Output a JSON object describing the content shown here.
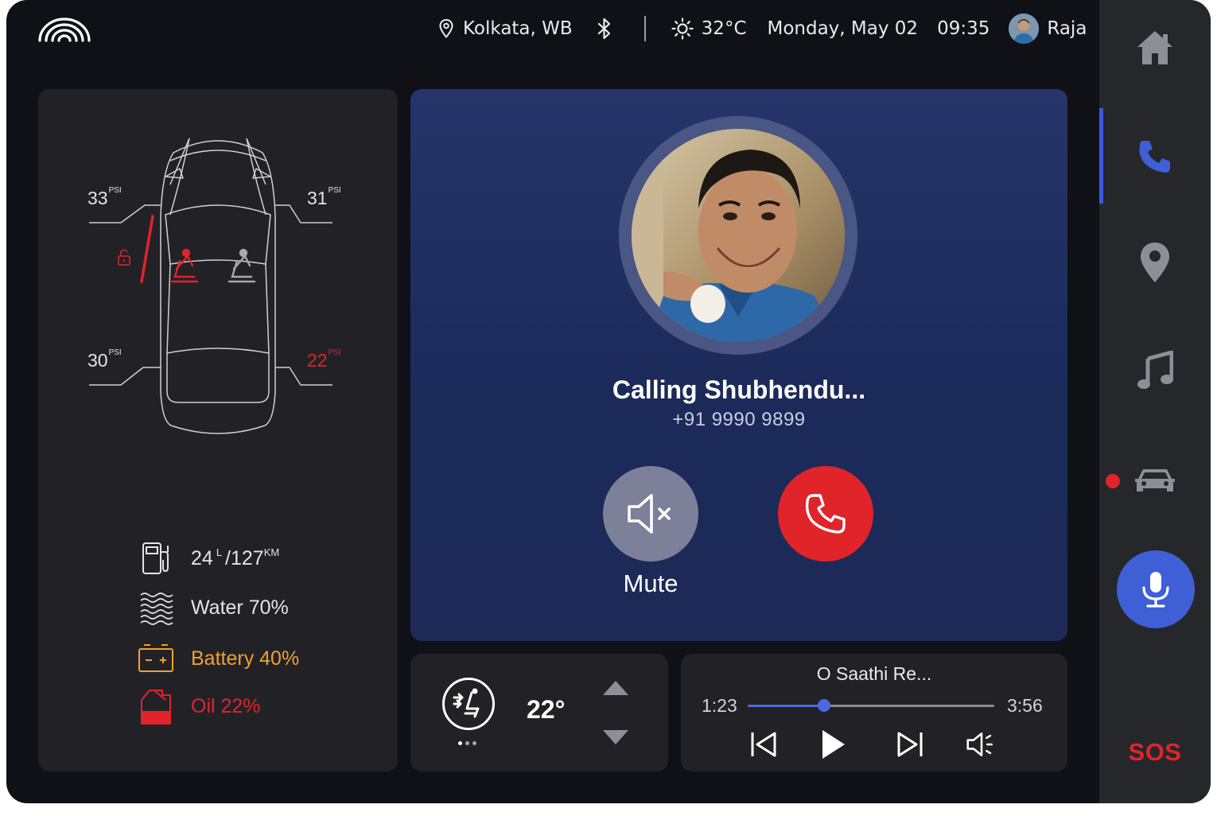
{
  "header": {
    "location": "Kolkata, WB",
    "temperature": "32°C",
    "date": "Monday, May 02",
    "time": "09:35",
    "user_name": "Raja"
  },
  "tire_pressure": {
    "front_left": "33",
    "front_right": "31",
    "rear_left": "30",
    "rear_right": "22",
    "unit": "PSI"
  },
  "stats": {
    "fuel_value": "24",
    "fuel_unit": "L",
    "range_value": "/127",
    "range_unit": "KM",
    "water": "Water 70%",
    "battery": "Battery 40%",
    "oil": "Oil 22%"
  },
  "call": {
    "title": "Calling Shubhendu...",
    "number": "+91 9990 9899",
    "mute_label": "Mute"
  },
  "climate": {
    "temperature": "22°"
  },
  "music": {
    "song_title": "O Saathi Re...",
    "elapsed": "1:23",
    "duration": "3:56",
    "progress": 0.31
  },
  "sidebar": {
    "sos_label": "SOS",
    "active": "phone"
  },
  "colors": {
    "accent": "#3e5fd6",
    "alert": "#e0242a",
    "warning": "#f0a030",
    "background": "#101116",
    "panel": "#222226"
  }
}
